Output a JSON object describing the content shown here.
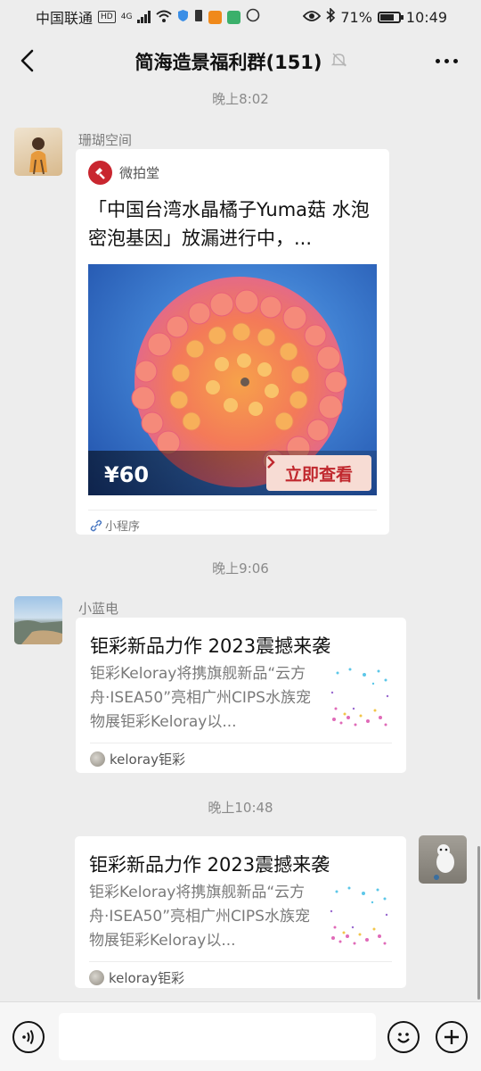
{
  "status_bar": {
    "carrier": "中国联通",
    "network_badge": "HD",
    "network_type": "4G",
    "battery": "71%",
    "time": "10:49",
    "icons": [
      "wifi-icon",
      "shield-icon",
      "sim-icon",
      "video-app-icon",
      "map-app-icon",
      "circle-icon",
      "eye-icon",
      "bluetooth-icon",
      "battery-icon"
    ]
  },
  "nav": {
    "title": "简海造景福利群(151)",
    "icons": [
      "back-arrow-icon",
      "mute-bell-icon",
      "more-dots-icon"
    ]
  },
  "messages": [
    {
      "time": "晚上8:02",
      "sender": "珊瑚空间",
      "type": "mini_program",
      "source": "微拍堂",
      "title": "「中国台湾水晶橘子Yuma菇 水泡 密泡基因」放漏进行中，...",
      "price": "¥60",
      "cta": "立即查看",
      "footer": "小程序"
    },
    {
      "time": "晚上9:06",
      "sender": "小蓝电",
      "type": "article",
      "title": "钜彩新品力作 2023震撼来袭",
      "desc": "钜彩Keloray将携旗舰新品“云方舟·ISEA50”亮相广州CIPS水族宠物展钜彩Keloray以...",
      "source": "keloray钜彩"
    },
    {
      "time": "晚上10:48",
      "sender": "",
      "type": "article",
      "title": "钜彩新品力作 2023震撼来袭",
      "desc": "钜彩Keloray将携旗舰新品“云方舟·ISEA50”亮相广州CIPS水族宠物展钜彩Keloray以...",
      "source": "keloray钜彩"
    }
  ],
  "input_bar": {
    "placeholder": "",
    "icons": [
      "voice-icon",
      "emoji-icon",
      "plus-icon"
    ]
  },
  "colors": {
    "background": "#ededed",
    "card": "#ffffff",
    "accent_red": "#c0272d",
    "muted_text": "#7a7a7a"
  }
}
